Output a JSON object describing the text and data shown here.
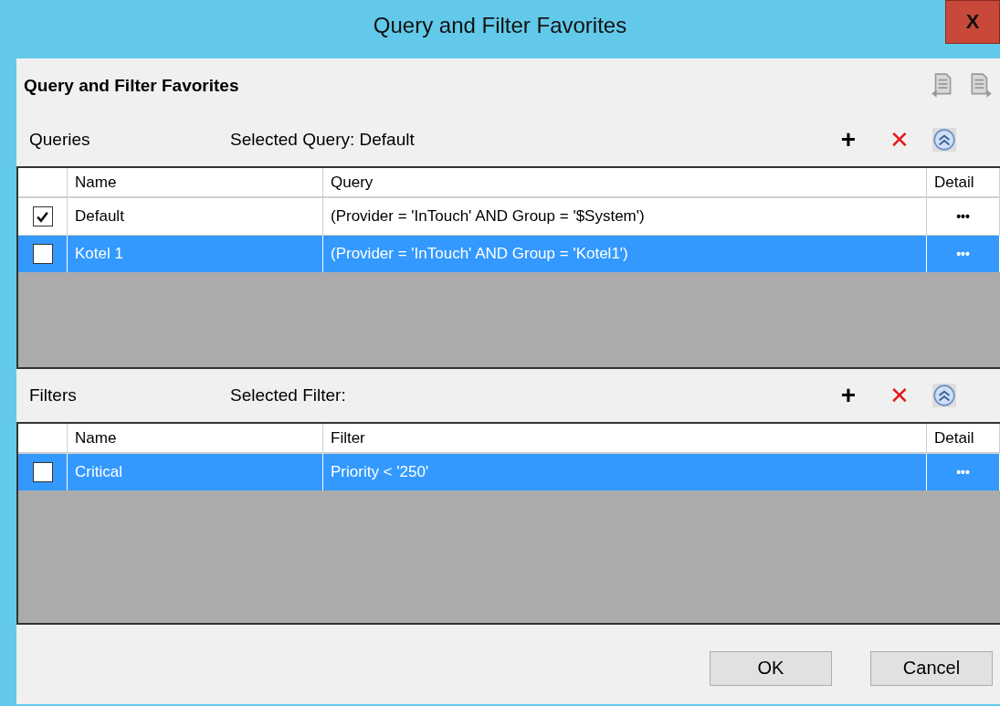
{
  "window": {
    "title": "Query and Filter Favorites",
    "close": "X"
  },
  "heading": "Query and Filter Favorites",
  "sections": [
    {
      "label": "Queries",
      "selected_label": "Selected Query: Default",
      "add": "+",
      "remove": "✕",
      "columns": [
        "Name",
        "Query",
        "Detail"
      ],
      "rows": [
        {
          "checked": true,
          "selected": false,
          "name": "Default",
          "value": "(Provider = 'InTouch' AND Group = '$System')",
          "detail": "•••"
        },
        {
          "checked": false,
          "selected": true,
          "name": "Kotel 1",
          "value": "(Provider = 'InTouch' AND Group = 'Kotel1')",
          "detail": "•••"
        }
      ]
    },
    {
      "label": "Filters",
      "selected_label": "Selected Filter:",
      "add": "+",
      "remove": "✕",
      "columns": [
        "Name",
        "Filter",
        "Detail"
      ],
      "rows": [
        {
          "checked": false,
          "selected": true,
          "name": "Critical",
          "value": "Priority < '250'",
          "detail": "•••"
        }
      ]
    }
  ],
  "buttons": [
    "OK",
    "Cancel"
  ]
}
